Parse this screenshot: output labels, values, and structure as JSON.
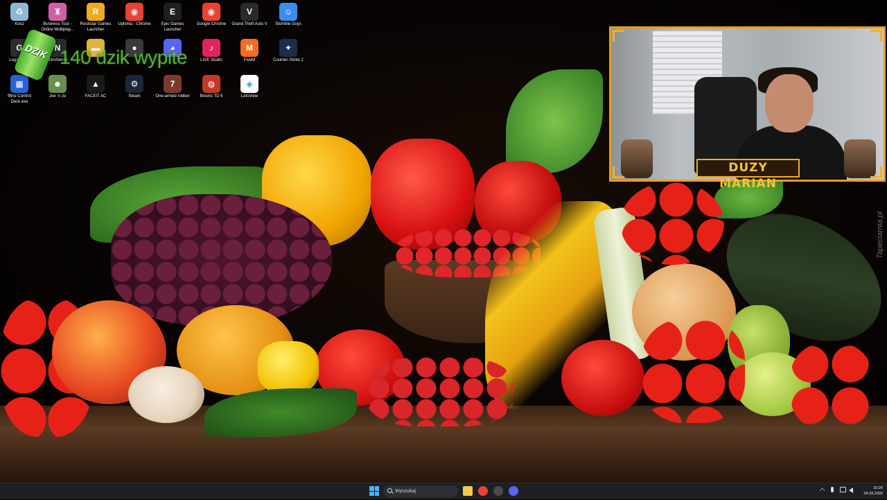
{
  "desktop": {
    "icons": [
      {
        "id": "recycle-bin",
        "label": "Kosz",
        "icon": "recycle-bin-icon",
        "color": "#8fb8d6"
      },
      {
        "id": "business-tour",
        "label": "Business Tour - Online Multiplay...",
        "icon": "business-tour-icon",
        "color": "#d35ea8"
      },
      {
        "id": "rockstar",
        "label": "Rockstar Games Launcher",
        "icon": "rockstar-icon",
        "color": "#f1a91d"
      },
      {
        "id": "chrome-profile",
        "label": "Uploma - Chrome",
        "icon": "chrome-icon",
        "color": "#e94235"
      },
      {
        "id": "epic",
        "label": "Epic Games Launcher",
        "icon": "epic-games-icon",
        "color": "#1f1f1f"
      },
      {
        "id": "google-chrome",
        "label": "Google Chrome",
        "icon": "chrome-icon",
        "color": "#e94235"
      },
      {
        "id": "gta5",
        "label": "Grand Theft Auto V",
        "icon": "gta5-icon",
        "color": "#2a2a2a"
      },
      {
        "id": "stumble",
        "label": "Stumble Guys",
        "icon": "stumble-guys-icon",
        "color": "#3b8cf0"
      },
      {
        "id": "logitech",
        "label": "Logitech G",
        "icon": "logitech-icon",
        "color": "#2d2d2d"
      },
      {
        "id": "nitrosense",
        "label": "NitroSense",
        "icon": "nitrosense-icon",
        "color": "#2a2a2a"
      },
      {
        "id": "folder",
        "label": "",
        "icon": "folder-icon",
        "color": "#e2b33b"
      },
      {
        "id": "obs",
        "label": "",
        "icon": "obs-icon",
        "color": "#3a3a3a"
      },
      {
        "id": "discord",
        "label": "",
        "icon": "discord-icon",
        "color": "#5865f2"
      },
      {
        "id": "tiktok",
        "label": "LIVE Studio",
        "icon": "tiktok-icon",
        "color": "#e0245e"
      },
      {
        "id": "fivem",
        "label": "FiveM",
        "icon": "fivem-icon",
        "color": "#f26c21"
      },
      {
        "id": "cs2",
        "label": "Counter-Strike 2",
        "icon": "counter-strike-icon",
        "color": "#1c2e4a"
      },
      {
        "id": "fifine",
        "label": "fifine Control Deck.exe",
        "icon": "fifine-icon",
        "color": "#2a62d3"
      },
      {
        "id": "joe-n-jo",
        "label": "Joe 'n Jo",
        "icon": "joe-n-jo-icon",
        "color": "#6b8e4e"
      },
      {
        "id": "faceit",
        "label": "FACEIT AC",
        "icon": "faceit-icon",
        "color": "#1a1a1a"
      },
      {
        "id": "steam",
        "label": "Steam",
        "icon": "steam-icon",
        "color": "#1b2838"
      },
      {
        "id": "one-armed",
        "label": "One-armed robber",
        "icon": "slot-machine-icon",
        "color": "#7a3b2e"
      },
      {
        "id": "bloons",
        "label": "Bloons TD 6",
        "icon": "bloons-icon",
        "color": "#c0392b"
      },
      {
        "id": "letsview",
        "label": "LetsView",
        "icon": "letsview-icon",
        "color": "#ffffff"
      }
    ]
  },
  "promo": {
    "can_text": "DZIK",
    "message": "140 dzik wypite"
  },
  "camera": {
    "streamer_name": "DUZY MARIAN"
  },
  "wallpaper": {
    "watermark": "Tapeciarnia.pl"
  },
  "taskbar": {
    "search_placeholder": "Wyszukaj",
    "pinned": [
      {
        "icon": "file-explorer-icon",
        "color": "#f2c94c"
      },
      {
        "icon": "chrome-icon",
        "color": "#e94235"
      },
      {
        "icon": "obs-icon",
        "color": "#4a4a4a"
      },
      {
        "icon": "discord-icon",
        "color": "#5865f2"
      }
    ],
    "time": "16:26",
    "date": "04.03.2026"
  }
}
